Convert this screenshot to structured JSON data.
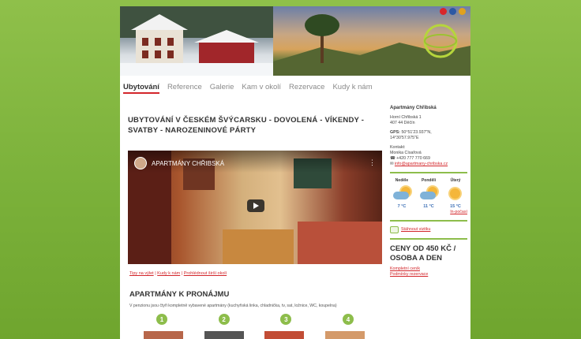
{
  "banner": {
    "flag_colors": [
      "#d8262b",
      "#2c58a4",
      "#e0a21e"
    ]
  },
  "nav": {
    "items": [
      "Ubytování",
      "Reference",
      "Galerie",
      "Kam v okolí",
      "Rezervace",
      "Kudy k nám"
    ]
  },
  "main": {
    "title": "UBYTOVÁNÍ V ČESKÉM ŠVÝCARSKU - DOVOLENÁ - VÍKENDY - SVATBY - NAROZENINOVÉ PÁRTY",
    "video": {
      "title": "APARTMÁNY CHŘIBSKÁ",
      "more": "⋮"
    },
    "links": [
      "Tipy na výlet",
      "Kudy k nám",
      "Prohlédnout širší okolí"
    ],
    "section_title": "APARTMÁNY K PRONÁJMU",
    "section_text": "V penzionu jsou čtyři kompletně vybavené apartmány (kuchyňská linka, chladnička, tv, sat, ložnice, WC, koupelna)",
    "apartment_numbers": [
      "1",
      "2",
      "3",
      "4"
    ]
  },
  "sidebar": {
    "title": "Apartmány Chřibská",
    "address": [
      "Horní Chřibská 1",
      "407 44 Děčín"
    ],
    "gps_label": "GPS:",
    "gps": [
      "50°51'23.937\"N,",
      "14°30'57.975\"E"
    ],
    "contact_label": "Kontakt:",
    "contact_name": "Monika Císařová",
    "phone": "+420 777 770 669",
    "email": "info@apartmany-chribska.cz",
    "weather": [
      {
        "day": "Neděle",
        "temp": "7 °C"
      },
      {
        "day": "Pondělí",
        "temp": "11 °C"
      },
      {
        "day": "Úterý",
        "temp": "15 °C"
      }
    ],
    "forecast_link": "In-počasí",
    "download": "Stáhnout vizitku",
    "price_title": "CENY OD 450 KČ / OSOBA A DEN",
    "price_links": [
      "Kompletní ceník",
      "Podmínky rezervace"
    ]
  }
}
